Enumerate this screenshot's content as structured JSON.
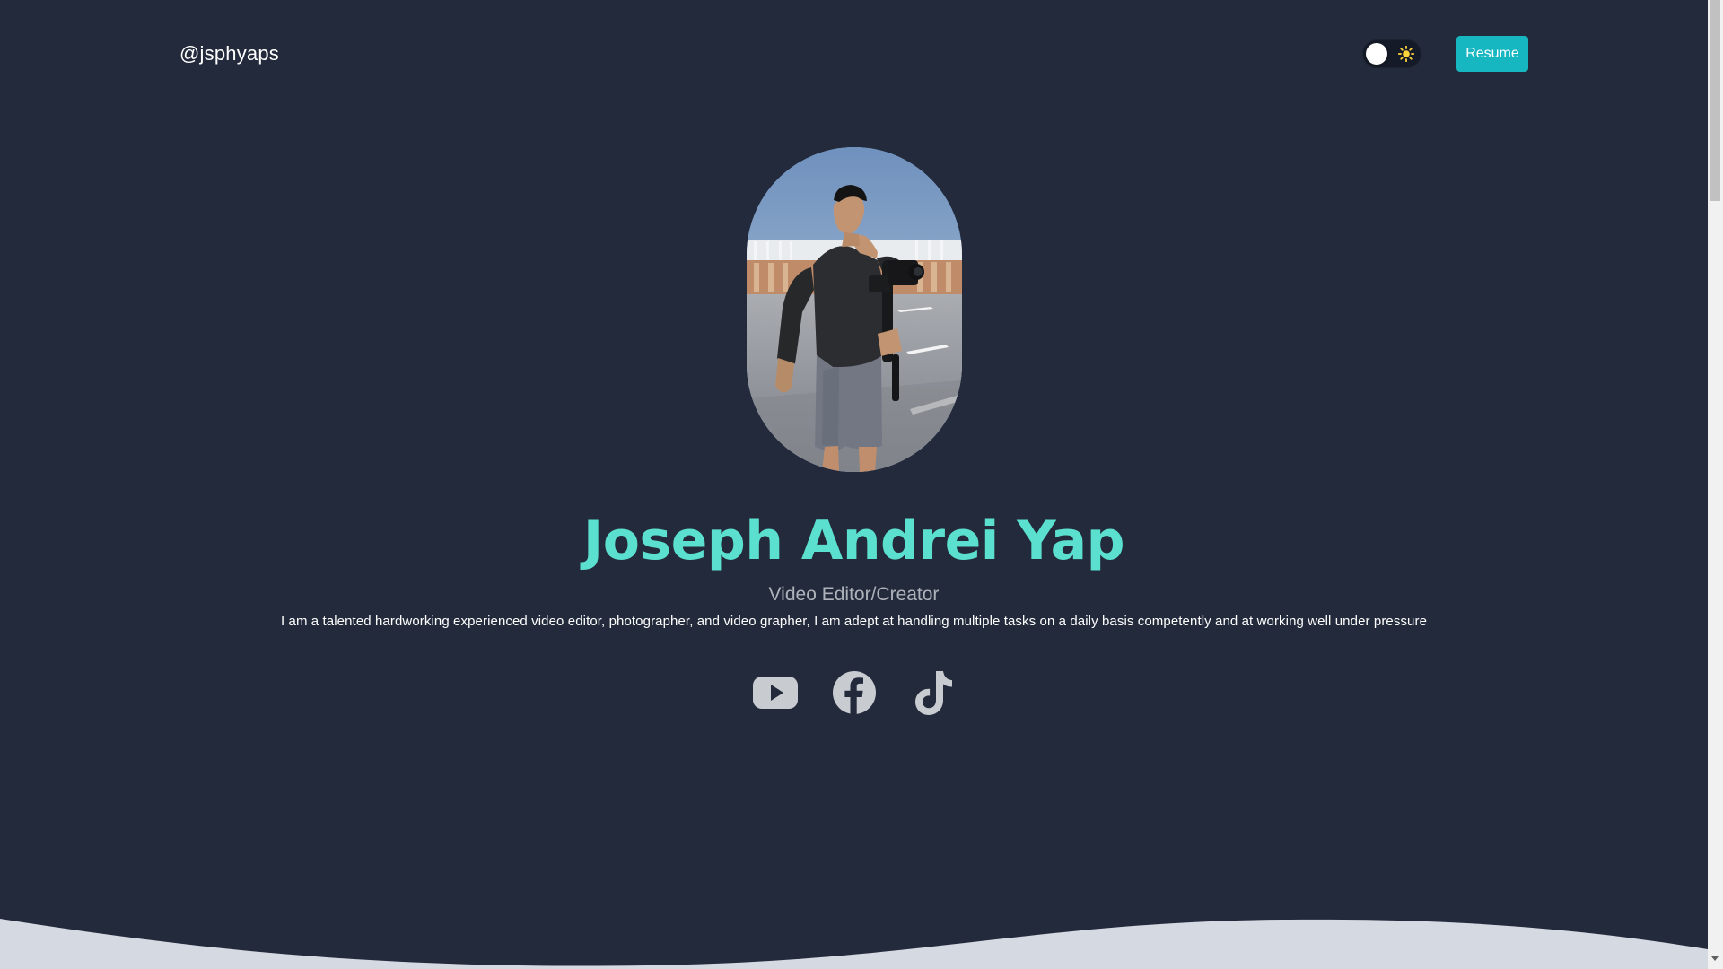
{
  "header": {
    "brand": "@jsphyaps",
    "resume_label": "Resume",
    "theme_toggle_state": "dark",
    "theme_icon": "sun-icon"
  },
  "hero": {
    "name": "Joseph Andrei Yap",
    "role": "Video Editor/Creator",
    "bio": "I am a talented hardworking experienced video editor, photographer, and video grapher, I am adept at handling multiple tasks on a daily basis competently and at working well under pressure",
    "avatar": "person-filming-with-camera-stabilizer-photo"
  },
  "social_links": [
    {
      "name": "YouTube",
      "icon": "youtube-icon"
    },
    {
      "name": "Facebook",
      "icon": "facebook-icon"
    },
    {
      "name": "TikTok",
      "icon": "tiktok-icon"
    }
  ],
  "colors": {
    "background": "#232a3b",
    "accent": "#5be0cf",
    "button": "#17b7c2",
    "social_icon": "#c8cbd0",
    "wave": "#d5d9e2"
  }
}
